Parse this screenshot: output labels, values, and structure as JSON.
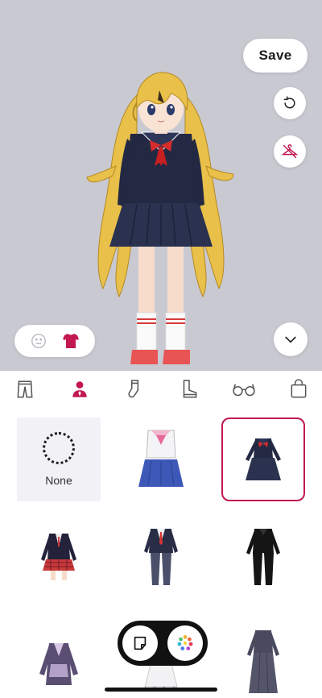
{
  "toolbar": {
    "save_label": "Save",
    "reset_icon": "rotate-ccw-icon",
    "hide_icon": "hanger-off-icon",
    "collapse_icon": "chevron-down-icon"
  },
  "mode_toggle": {
    "options": [
      "face-icon",
      "shirt-icon"
    ],
    "selected": "shirt-icon"
  },
  "tabs": [
    {
      "icon": "pants-icon"
    },
    {
      "icon": "person-icon",
      "selected": true
    },
    {
      "icon": "sock-icon"
    },
    {
      "icon": "boot-icon"
    },
    {
      "icon": "glasses-icon"
    },
    {
      "icon": "bag-icon"
    }
  ],
  "items": [
    {
      "label": "None",
      "icon": "empty-circle-icon"
    },
    {
      "icon": "sailor-uniform-icon"
    },
    {
      "icon": "navy-dress-ribbon-icon",
      "selected": true
    },
    {
      "icon": "blazer-plaid-skirt-icon"
    },
    {
      "icon": "suit-red-tie-icon"
    },
    {
      "icon": "black-jumpsuit-icon"
    },
    {
      "icon": "purple-coat-icon"
    },
    {
      "icon": "white-frill-dress-icon"
    },
    {
      "icon": "grey-long-dress-icon"
    }
  ],
  "bottom_bar": {
    "left_icon": "sticker-icon",
    "right_icon": "palette-icon"
  },
  "colors": {
    "accent": "#c2184f",
    "stage_bg": "#f3f3f7",
    "none_cell_bg": "#f1f1f6"
  }
}
